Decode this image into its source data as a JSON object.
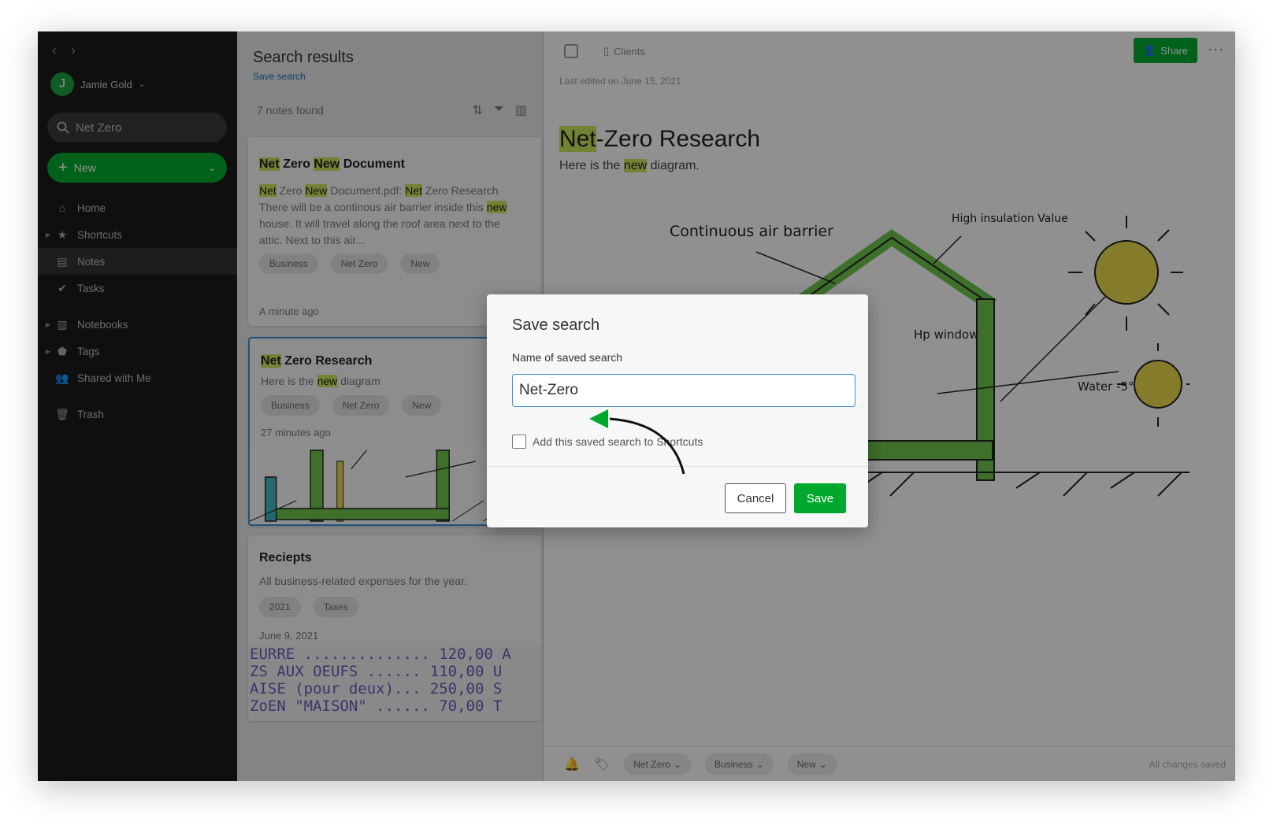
{
  "sidebar": {
    "user_initial": "J",
    "user_name": "Jamie Gold",
    "search_value": "Net Zero",
    "new_label": "New",
    "items": [
      {
        "label": "Home",
        "icon": "home-icon"
      },
      {
        "label": "Shortcuts",
        "icon": "star-icon"
      },
      {
        "label": "Notes",
        "icon": "note-icon"
      },
      {
        "label": "Tasks",
        "icon": "check-circle-icon"
      },
      {
        "label": "Notebooks",
        "icon": "notebook-icon"
      },
      {
        "label": "Tags",
        "icon": "tag-icon"
      },
      {
        "label": "Shared with Me",
        "icon": "people-icon"
      },
      {
        "label": "Trash",
        "icon": "trash-icon"
      }
    ]
  },
  "list": {
    "title": "Search results",
    "save_link": "Save search",
    "found": "7 notes found",
    "cards": [
      {
        "title_parts": [
          "Net",
          " Zero ",
          "New",
          " Document"
        ],
        "body_parts": [
          "Net",
          " Zero ",
          "New",
          " Document.pdf: ",
          "Net",
          " Zero Research There will be a continous air barrier inside this ",
          "new",
          " house. It will travel along the roof area next to the attic. Next to this air..."
        ],
        "tags": [
          "Business",
          "Net Zero",
          "New"
        ],
        "date": "A minute ago"
      },
      {
        "title_parts": [
          "Net",
          " Zero Research"
        ],
        "body_parts": [
          "Here is the ",
          "new",
          " diagram"
        ],
        "tags": [
          "Business",
          "Net Zero",
          "New"
        ],
        "date": "27 minutes ago"
      },
      {
        "title": "Reciepts",
        "body": "All business-related expenses for the year.",
        "tags": [
          "2021",
          "Taxes"
        ],
        "date": "June 9, 2021",
        "receipt_lines": [
          "EURRE .............. 120,00 A",
          "ZS AUX OEUFS ...... 110,00 U",
          "AISE (pour deux)... 250,00 S",
          "ZoEN \"MAISON\" ...... 70,00 T"
        ]
      }
    ]
  },
  "editor": {
    "notebook": "Clients",
    "share_label": "Share",
    "last_edited": "Last edited on June 15, 2021",
    "title_highlight": "Net",
    "title_rest": "-Zero Research",
    "body_before": "Here is the ",
    "body_highlight": "new",
    "body_after": " diagram.",
    "sketch_labels": [
      "Continuous air barrier",
      "High insulation Value",
      "Hp window",
      "Water -5°"
    ],
    "bottom_tags": [
      "Net Zero",
      "Business",
      "New"
    ],
    "status": "All changes saved"
  },
  "modal": {
    "title": "Save search",
    "field_label": "Name of  saved search",
    "field_value": "Net-Zero",
    "checkbox_label": "Add this saved search to Shortcuts",
    "cancel_label": "Cancel",
    "save_label": "Save"
  },
  "colors": {
    "accent_green": "#00a82d",
    "highlight": "#c7e25b",
    "focus_blue": "#3a8ed6",
    "sidebar_bg": "#1a1a1a"
  }
}
